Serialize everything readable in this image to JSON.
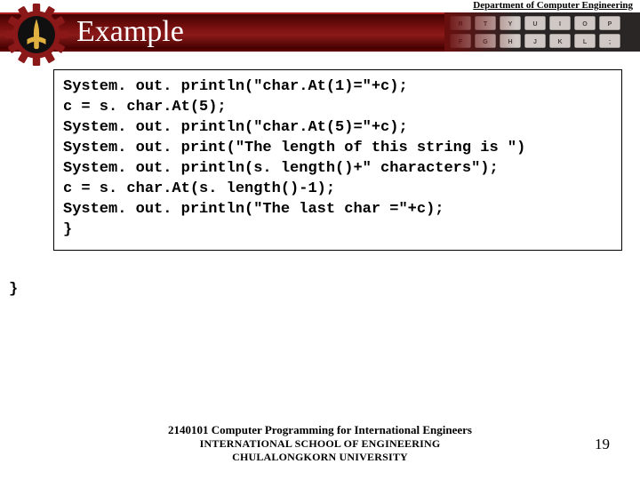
{
  "header": {
    "department": "Department of Computer Engineering",
    "title": "Example"
  },
  "code": {
    "lines": [
      "System. out. println(\"char.At(1)=\"+c);",
      "c = s. char.At(5);",
      "System. out. println(\"char.At(5)=\"+c);",
      "System. out. print(\"The length of this string is \")",
      "System. out. println(s. length()+\" characters\");",
      "c = s. char.At(s. length()-1);",
      "System. out. println(\"The last char =\"+c);",
      "}"
    ],
    "stray_brace": "}"
  },
  "footer": {
    "line1": "2140101 Computer Programming for International Engineers",
    "line2": "INTERNATIONAL SCHOOL OF ENGINEERING",
    "line3": "CHULALONGKORN UNIVERSITY",
    "page": "19"
  }
}
